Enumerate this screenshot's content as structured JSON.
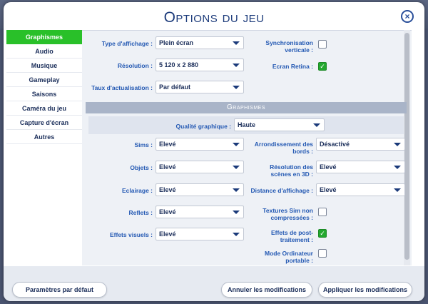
{
  "window": {
    "title": "Options du jeu",
    "close_glyph": "×"
  },
  "sidebar": {
    "items": [
      {
        "label": "Graphismes",
        "active": true
      },
      {
        "label": "Audio"
      },
      {
        "label": "Musique"
      },
      {
        "label": "Gameplay"
      },
      {
        "label": "Saisons"
      },
      {
        "label": "Caméra du jeu"
      },
      {
        "label": "Capture d'écran"
      },
      {
        "label": "Autres"
      }
    ]
  },
  "display": {
    "type_label": "Type d'affichage :",
    "type_value": "Plein écran",
    "resolution_label": "Résolution :",
    "resolution_value": "5 120 x 2 880",
    "refresh_label": "Taux d'actualisation :",
    "refresh_value": "Par défaut",
    "vsync_label": "Synchronisation verticale :",
    "vsync_checked": false,
    "retina_label": "Ecran Retina :",
    "retina_checked": true
  },
  "graphics": {
    "section_title": "Graphismes",
    "quality_label": "Qualité graphique :",
    "quality_value": "Haute",
    "sims_label": "Sims :",
    "sims_value": "Elevé",
    "objects_label": "Objets :",
    "objects_value": "Elevé",
    "lighting_label": "Eclairage :",
    "lighting_value": "Elevé",
    "reflections_label": "Reflets :",
    "reflections_value": "Elevé",
    "visual_effects_label": "Effets visuels :",
    "visual_effects_value": "Elevé",
    "edge_smoothing_label": "Arrondissement des bords :",
    "edge_smoothing_value": "Désactivé",
    "scene_res_label": "Résolution des scènes en 3D :",
    "scene_res_value": "Elevé",
    "view_distance_label": "Distance d'affichage :",
    "view_distance_value": "Elevé",
    "uncompressed_label": "Textures Sim non compressées :",
    "uncompressed_checked": false,
    "post_processing_label": "Effets de post-traitement :",
    "post_processing_checked": true,
    "laptop_mode_label": "Mode Ordinateur portable :",
    "laptop_mode_checked": false
  },
  "footer": {
    "defaults_label": "Paramètres par défaut",
    "cancel_label": "Annuler les modifications",
    "apply_label": "Appliquer les modifications"
  },
  "colors": {
    "accent_active": "#29c029",
    "check_green": "#23a82f",
    "label_blue": "#2459b3"
  }
}
